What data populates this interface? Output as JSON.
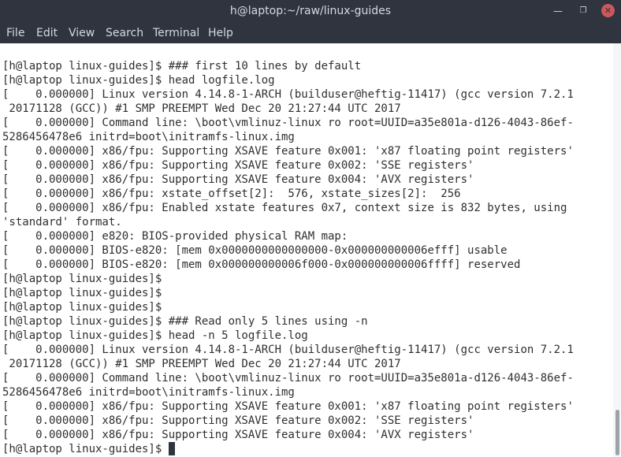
{
  "window": {
    "title": "h@laptop:~/raw/linux-guides",
    "minimize_glyph": "—",
    "maximize_glyph": "❐",
    "close_glyph": "✕"
  },
  "menu": [
    "File",
    "Edit",
    "View",
    "Search",
    "Terminal",
    "Help"
  ],
  "terminal": {
    "lines": [
      "",
      "[h@laptop linux-guides]$ ### first 10 lines by default",
      "[h@laptop linux-guides]$ head logfile.log",
      "[    0.000000] Linux version 4.14.8-1-ARCH (builduser@heftig-11417) (gcc version 7.2.1",
      " 20171128 (GCC)) #1 SMP PREEMPT Wed Dec 20 21:27:44 UTC 2017",
      "[    0.000000] Command line: \\boot\\vmlinuz-linux ro root=UUID=a35e801a-d126-4043-86ef-",
      "5286456478e6 initrd=boot\\initramfs-linux.img",
      "[    0.000000] x86/fpu: Supporting XSAVE feature 0x001: 'x87 floating point registers'",
      "[    0.000000] x86/fpu: Supporting XSAVE feature 0x002: 'SSE registers'",
      "[    0.000000] x86/fpu: Supporting XSAVE feature 0x004: 'AVX registers'",
      "[    0.000000] x86/fpu: xstate_offset[2]:  576, xstate_sizes[2]:  256",
      "[    0.000000] x86/fpu: Enabled xstate features 0x7, context size is 832 bytes, using",
      "'standard' format.",
      "[    0.000000] e820: BIOS-provided physical RAM map:",
      "[    0.000000] BIOS-e820: [mem 0x0000000000000000-0x000000000006efff] usable",
      "[    0.000000] BIOS-e820: [mem 0x000000000006f000-0x000000000006ffff] reserved",
      "[h@laptop linux-guides]$",
      "[h@laptop linux-guides]$",
      "[h@laptop linux-guides]$",
      "[h@laptop linux-guides]$ ### Read only 5 lines using -n",
      "[h@laptop linux-guides]$ head -n 5 logfile.log",
      "[    0.000000] Linux version 4.14.8-1-ARCH (builduser@heftig-11417) (gcc version 7.2.1",
      " 20171128 (GCC)) #1 SMP PREEMPT Wed Dec 20 21:27:44 UTC 2017",
      "[    0.000000] Command line: \\boot\\vmlinuz-linux ro root=UUID=a35e801a-d126-4043-86ef-",
      "5286456478e6 initrd=boot\\initramfs-linux.img",
      "[    0.000000] x86/fpu: Supporting XSAVE feature 0x001: 'x87 floating point registers'",
      "[    0.000000] x86/fpu: Supporting XSAVE feature 0x002: 'SSE registers'",
      "[    0.000000] x86/fpu: Supporting XSAVE feature 0x004: 'AVX registers'",
      "[h@laptop linux-guides]$ "
    ]
  },
  "colors": {
    "titlebar_bg": "#2f343f",
    "titlebar_text": "#d3dae3",
    "close_button": "#cc575d",
    "terminal_bg": "#ffffff",
    "terminal_text": "#2f2f2f"
  }
}
